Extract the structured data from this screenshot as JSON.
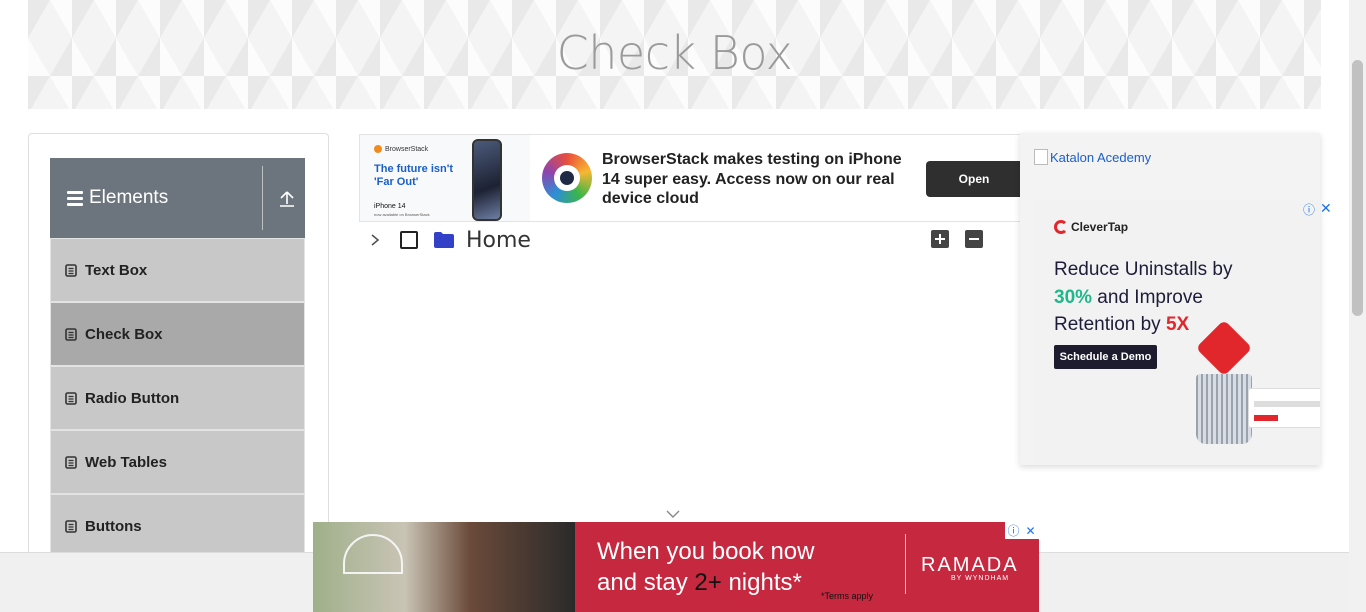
{
  "header": {
    "title": "Check Box"
  },
  "sidebar": {
    "group_title": "Elements",
    "items": [
      {
        "label": "Text Box",
        "active": false
      },
      {
        "label": "Check Box",
        "active": true
      },
      {
        "label": "Radio Button",
        "active": false
      },
      {
        "label": "Web Tables",
        "active": false
      },
      {
        "label": "Buttons",
        "active": false
      }
    ]
  },
  "tree": {
    "root_label": "Home",
    "checked": false,
    "expanded": false
  },
  "ads": {
    "top": {
      "brand": "BrowserStack",
      "tagline": "The future isn't 'Far Out'",
      "product": "iPhone 14",
      "product_sub": "now available on BrowserStack",
      "headline": "BrowserStack makes testing on iPhone 14 super easy. Access now on our real device cloud",
      "cta": "Open"
    },
    "right": {
      "broken_image_alt": "Katalon Acedemy",
      "brand": "CleverTap",
      "line1": "Reduce Uninstalls by",
      "highlight1": "30%",
      "line2": " and Improve Retention by ",
      "highlight2": "5X",
      "cta": "Schedule a Demo"
    },
    "bottom": {
      "line1": "When you book now",
      "line2a": "and stay ",
      "line2b": "2+",
      "line2c": " nights*",
      "terms": "*Terms apply",
      "brand": "RAMADA",
      "brand_sub": "BY WYNDHAM"
    }
  },
  "colors": {
    "menu_header": "#6c757d",
    "menu_item": "#c8c8c8",
    "menu_active": "#a9a9a9",
    "ad_red": "#c6283f",
    "clevertap_red": "#e2272c",
    "clevertap_green": "#1eb88a"
  }
}
